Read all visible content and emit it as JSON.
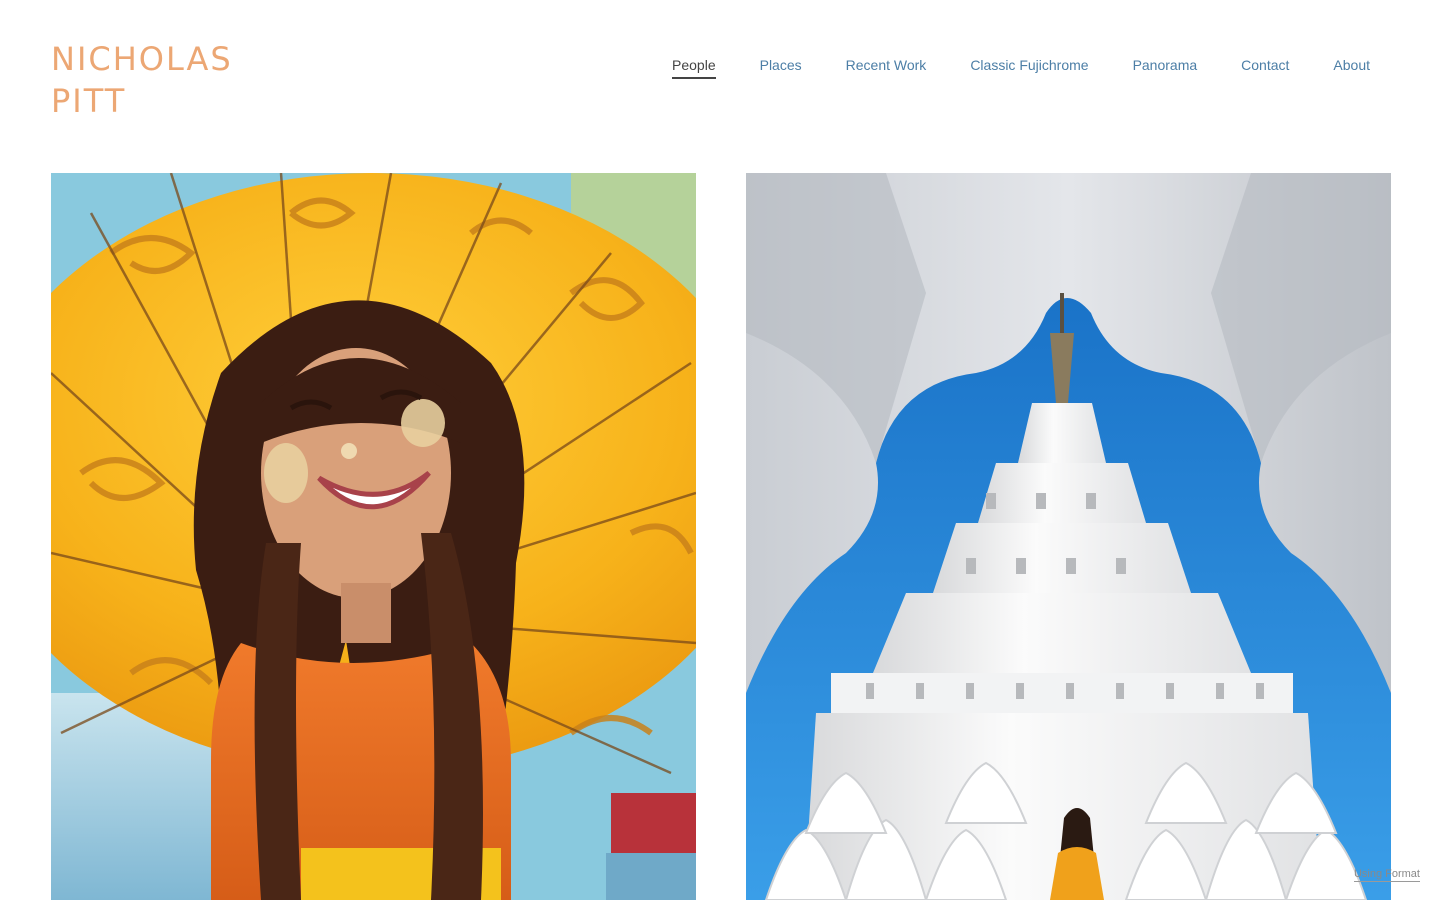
{
  "brand": {
    "line1": "NICHOLAS",
    "line2": "PITT",
    "color": "#eca774"
  },
  "nav": {
    "items": [
      {
        "label": "People",
        "active": true
      },
      {
        "label": "Places",
        "active": false
      },
      {
        "label": "Recent Work",
        "active": false
      },
      {
        "label": "Classic Fujichrome",
        "active": false
      },
      {
        "label": "Panorama",
        "active": false
      },
      {
        "label": "Contact",
        "active": false
      },
      {
        "label": "About",
        "active": false
      }
    ],
    "link_color": "#4c7ea6",
    "active_color": "#444444"
  },
  "gallery": {
    "photos": [
      {
        "subject": "smiling girl with orange paper umbrella"
      },
      {
        "subject": "white pagoda framed by arch with woman in orange"
      }
    ]
  },
  "footer": {
    "using_format": "Using Format"
  }
}
